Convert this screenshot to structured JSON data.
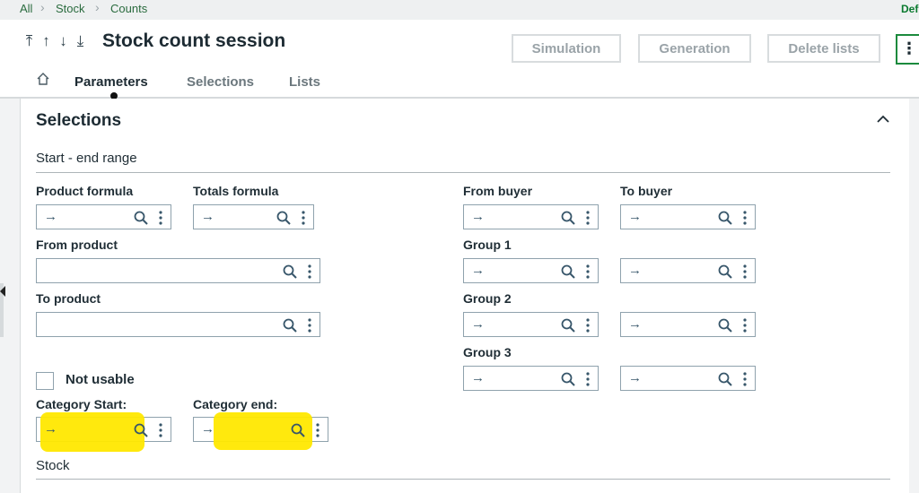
{
  "breadcrumb": [
    "All",
    "Stock",
    "Counts"
  ],
  "topbar_right": "Def",
  "nav_arrows": [
    "⤒",
    "↑",
    "↓",
    "⤓"
  ],
  "title": "Stock count session",
  "actions": {
    "simulation": "Simulation",
    "generation": "Generation",
    "delete_lists": "Delete lists",
    "more": "⋮"
  },
  "tabs": [
    {
      "label": "Parameters",
      "active": true
    },
    {
      "label": "Selections",
      "active": false
    },
    {
      "label": "Lists",
      "active": false
    }
  ],
  "section": {
    "title": "Selections",
    "subheading": "Start - end range",
    "footer_heading": "Stock",
    "labels": {
      "product_formula": "Product formula",
      "totals_formula": "Totals formula",
      "from_product": "From product",
      "to_product": "To product",
      "from_buyer": "From buyer",
      "to_buyer": "To buyer",
      "group1": "Group 1",
      "group2": "Group 2",
      "group3": "Group 3",
      "not_usable": "Not usable",
      "category_start": "Category Start:",
      "category_end": "Category end:"
    },
    "field_arrow": "→",
    "not_usable_checked": false
  },
  "colors": {
    "brand_green": "#1b8a3d",
    "highlight": "#ffe800"
  }
}
